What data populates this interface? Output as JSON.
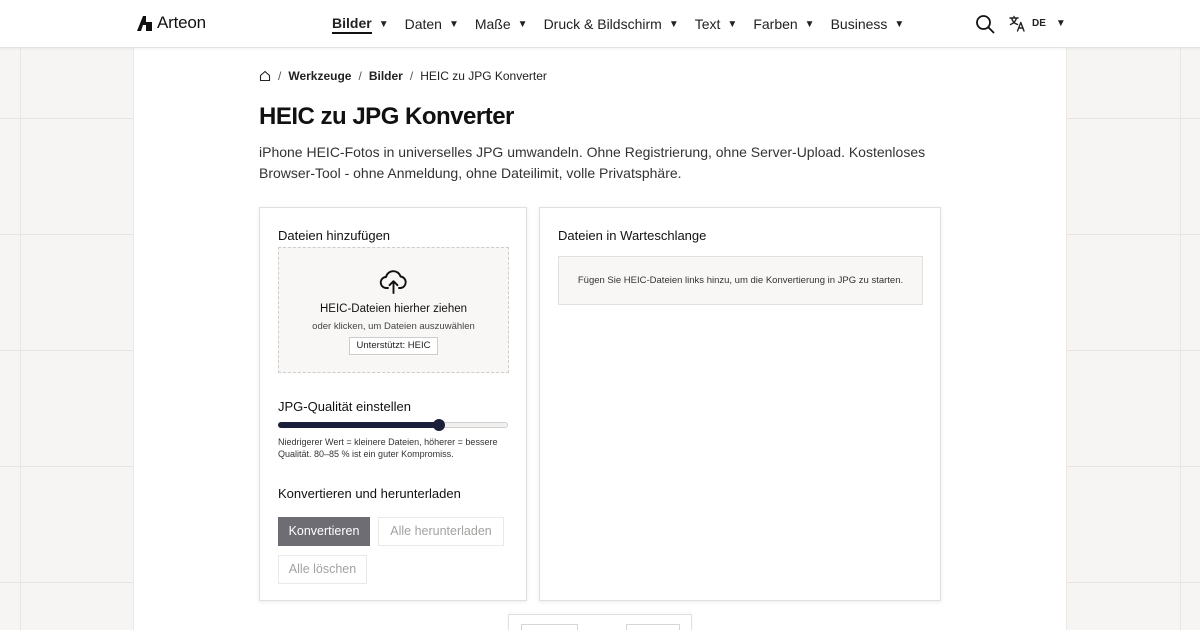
{
  "brand": {
    "name": "Arteon"
  },
  "nav": {
    "items": [
      {
        "label": "Bilder",
        "active": true
      },
      {
        "label": "Daten"
      },
      {
        "label": "Maße"
      },
      {
        "label": "Druck & Bildschirm"
      },
      {
        "label": "Text"
      },
      {
        "label": "Farben"
      },
      {
        "label": "Business"
      }
    ],
    "caret": "▼",
    "language": "DE"
  },
  "breadcrumb": {
    "separator": "/",
    "items": [
      "Werkzeuge",
      "Bilder"
    ],
    "current": "HEIC zu JPG Konverter"
  },
  "page": {
    "title": "HEIC zu JPG Konverter",
    "description": "iPhone HEIC-Fotos in universelles JPG umwandeln. Ohne Registrierung, ohne Server-Upload. Kostenloses Browser-Tool - ohne Anmeldung, ohne Dateilimit, volle Privatsphäre."
  },
  "upload": {
    "title": "Dateien hinzufügen",
    "drop_title": "HEIC-Dateien hierher ziehen",
    "drop_subtitle": "oder klicken, um Dateien auszuwählen",
    "supported": "Unterstützt: HEIC",
    "icon": "cloud-upload-icon"
  },
  "quality": {
    "title": "JPG-Qualität einstellen",
    "value_fraction": 0.7,
    "hint": "Niedrigerer Wert = kleinere Dateien, höherer = bessere Qualität. 80–85 % ist ein guter Kompromiss."
  },
  "actions": {
    "title": "Konvertieren und herunterladen",
    "convert": "Konvertieren",
    "download_all": "Alle herunterladen",
    "delete_all": "Alle löschen"
  },
  "queue": {
    "title": "Dateien in Warteschlange",
    "empty": "Fügen Sie HEIC-Dateien links hinzu, um die Konvertierung in JPG zu starten."
  },
  "colors": {
    "accent": "#1c1f3a",
    "primary_button": "#6e6d73",
    "disabled_text": "#a3a2a0"
  }
}
